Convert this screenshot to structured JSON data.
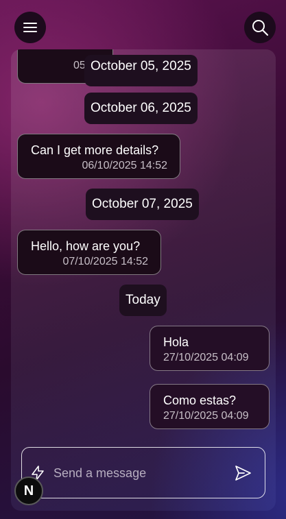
{
  "header": {
    "menu_icon": "hamburger-menu-icon",
    "search_icon": "search-icon"
  },
  "messages": [
    {
      "type": "incoming",
      "text": "",
      "timestamp": "05/"
    },
    {
      "type": "date",
      "label": "October 05, 2025"
    },
    {
      "type": "date",
      "label": "October 06, 2025"
    },
    {
      "type": "incoming",
      "text": "Can I get more details?",
      "timestamp": "06/10/2025 14:52"
    },
    {
      "type": "date",
      "label": "October 07, 2025"
    },
    {
      "type": "incoming",
      "text": "Hello, how are you?",
      "timestamp": "07/10/2025 14:52"
    },
    {
      "type": "date",
      "label": "Today"
    },
    {
      "type": "outgoing",
      "text": "Hola",
      "timestamp": "27/10/2025 04:09"
    },
    {
      "type": "outgoing",
      "text": "Como estas?",
      "timestamp": "27/10/2025 04:09"
    }
  ],
  "composer": {
    "placeholder": "Send a message",
    "attach_icon": "lightning-bolt-icon",
    "send_icon": "send-icon"
  },
  "badge": {
    "label": "N"
  }
}
